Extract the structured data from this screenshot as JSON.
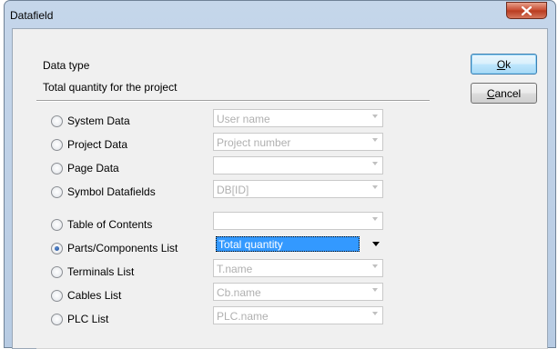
{
  "window": {
    "title": "Datafield",
    "close_icon": "close-x-icon",
    "accent_color": "#c74a2f"
  },
  "group": {
    "label": "Data type",
    "selection_text": "Total quantity for the project"
  },
  "buttons": {
    "ok_label": "Ok",
    "ok_mnemonic": "O",
    "cancel_label": "Cancel",
    "cancel_mnemonic": "C"
  },
  "options": [
    {
      "label": "System Data",
      "checked": false,
      "combo_value": "User name",
      "combo_enabled": false
    },
    {
      "label": "Project Data",
      "checked": false,
      "combo_value": "Project number",
      "combo_enabled": false
    },
    {
      "label": "Page Data",
      "checked": false,
      "combo_value": "",
      "combo_enabled": false
    },
    {
      "label": "Symbol Datafields",
      "checked": false,
      "combo_value": "DB[ID]",
      "combo_enabled": false
    },
    {
      "label": "Table of Contents",
      "checked": false,
      "combo_value": "",
      "combo_enabled": false
    },
    {
      "label": "Parts/Components List",
      "checked": true,
      "combo_value": "Total quantity",
      "combo_enabled": true
    },
    {
      "label": "Terminals List",
      "checked": false,
      "combo_value": "T.name",
      "combo_enabled": false
    },
    {
      "label": "Cables List",
      "checked": false,
      "combo_value": "Cb.name",
      "combo_enabled": false
    },
    {
      "label": "PLC List",
      "checked": false,
      "combo_value": "PLC.name",
      "combo_enabled": false
    }
  ]
}
